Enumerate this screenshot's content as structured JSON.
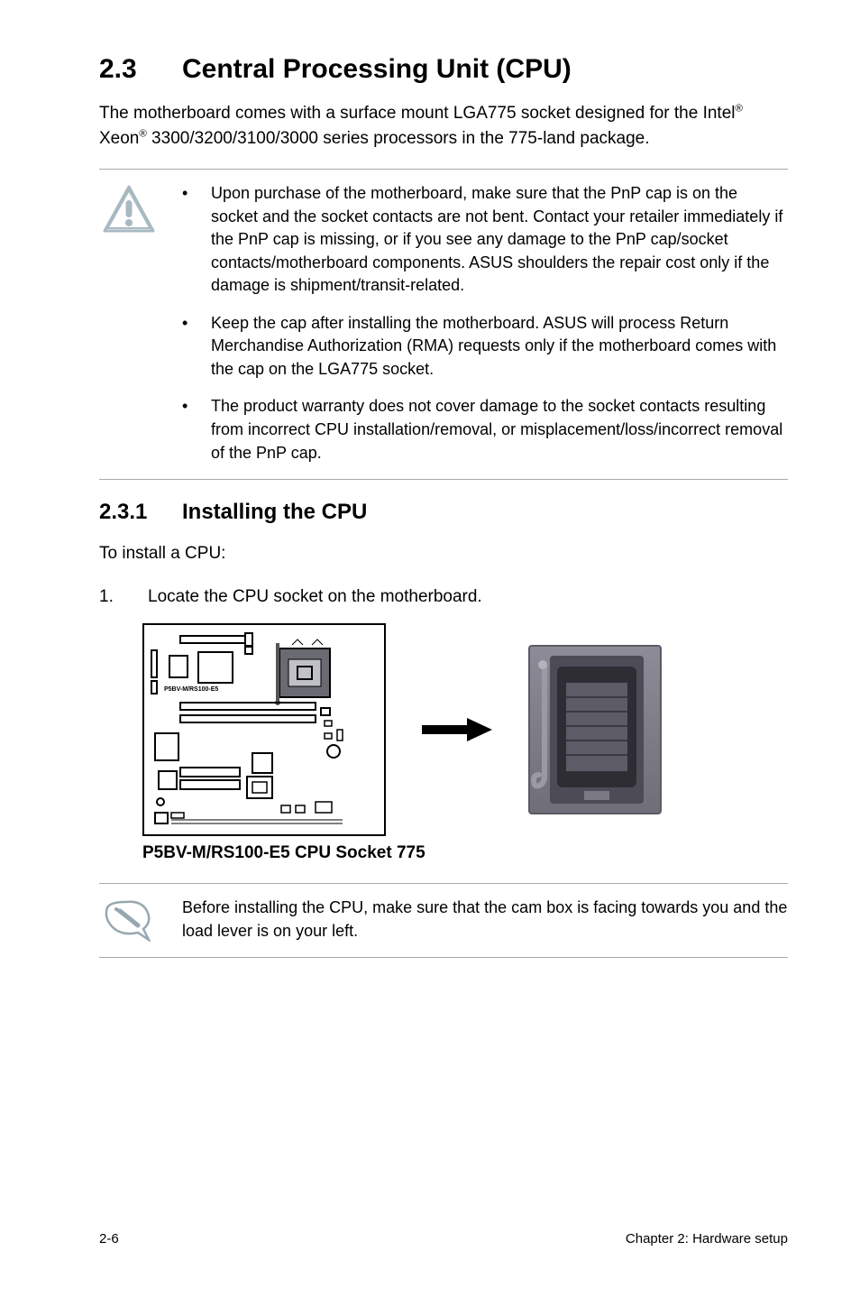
{
  "section": {
    "number": "2.3",
    "title": "Central Processing Unit (CPU)"
  },
  "intro": {
    "pre": "The motherboard comes with a surface mount LGA775 socket designed for the Intel",
    "mid": " Xeon",
    "post": " 3300/3200/3100/3000 series processors in the 775-land package."
  },
  "warning": {
    "items": [
      "Upon purchase of the motherboard, make sure that the PnP cap is on the socket and the socket contacts are not bent. Contact your retailer immediately if the PnP cap is missing, or if you see any damage to the PnP cap/socket contacts/motherboard components. ASUS shoulders the repair cost only if the damage is shipment/transit-related.",
      "Keep the cap after installing the motherboard. ASUS will process Return Merchandise Authorization (RMA) requests only if the motherboard comes with the cap on the LGA775 socket.",
      "The product warranty does not cover damage to the socket contacts resulting from incorrect CPU installation/removal, or misplacement/loss/incorrect removal of the PnP cap."
    ]
  },
  "subsection": {
    "number": "2.3.1",
    "title": "Installing the CPU"
  },
  "install_intro": "To install a CPU:",
  "steps": [
    {
      "n": "1.",
      "text": "Locate the CPU socket on the motherboard."
    }
  ],
  "board_label": "P5BV-M/RS100-E5",
  "caption": "P5BV-M/RS100-E5 CPU Socket 775",
  "note": "Before installing the CPU, make sure that the cam box is facing towards you and the load lever is on your left.",
  "footer": {
    "left": "2-6",
    "right": "Chapter 2:  Hardware setup"
  }
}
